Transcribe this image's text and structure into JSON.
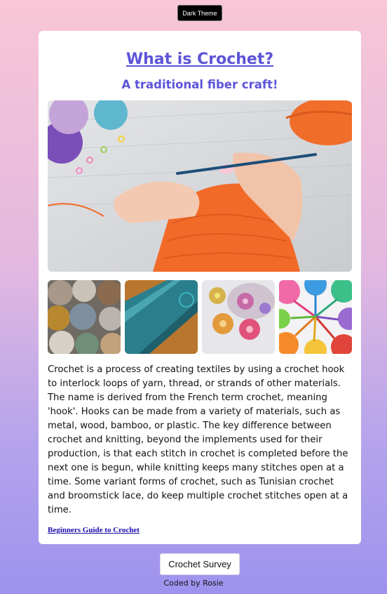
{
  "theme_button": {
    "label": "Dark Theme"
  },
  "article": {
    "title": "What is Crochet?",
    "subtitle": "A traditional fiber craft!",
    "hero_image": "hands-crocheting-orange-yarn",
    "thumbnails": [
      {
        "name": "yarn-balls-photo"
      },
      {
        "name": "blue-crochet-fabric-photo"
      },
      {
        "name": "crochet-flowers-photo"
      },
      {
        "name": "colorful-hooks-photo"
      }
    ],
    "body": "Crochet is a process of creating textiles by using a crochet hook to interlock loops of yarn, thread, or strands of other materials. The name is derived from the French term crochet, meaning 'hook'. Hooks can be made from a variety of materials, such as metal, wood, bamboo, or plastic. The key difference between crochet and knitting, beyond the implements used for their production, is that each stitch in crochet is completed before the next one is begun, while knitting keeps many stitches open at a time. Some variant forms of crochet, such as Tunisian crochet and broomstick lace, do keep multiple crochet stitches open at a time.",
    "link_label": "Beginners Guide to Crochet"
  },
  "footer": {
    "survey_button": "Crochet Survey",
    "credit": "Coded by Rosie"
  },
  "colors": {
    "accent": "#5d54d8",
    "link": "#1a0dab"
  }
}
